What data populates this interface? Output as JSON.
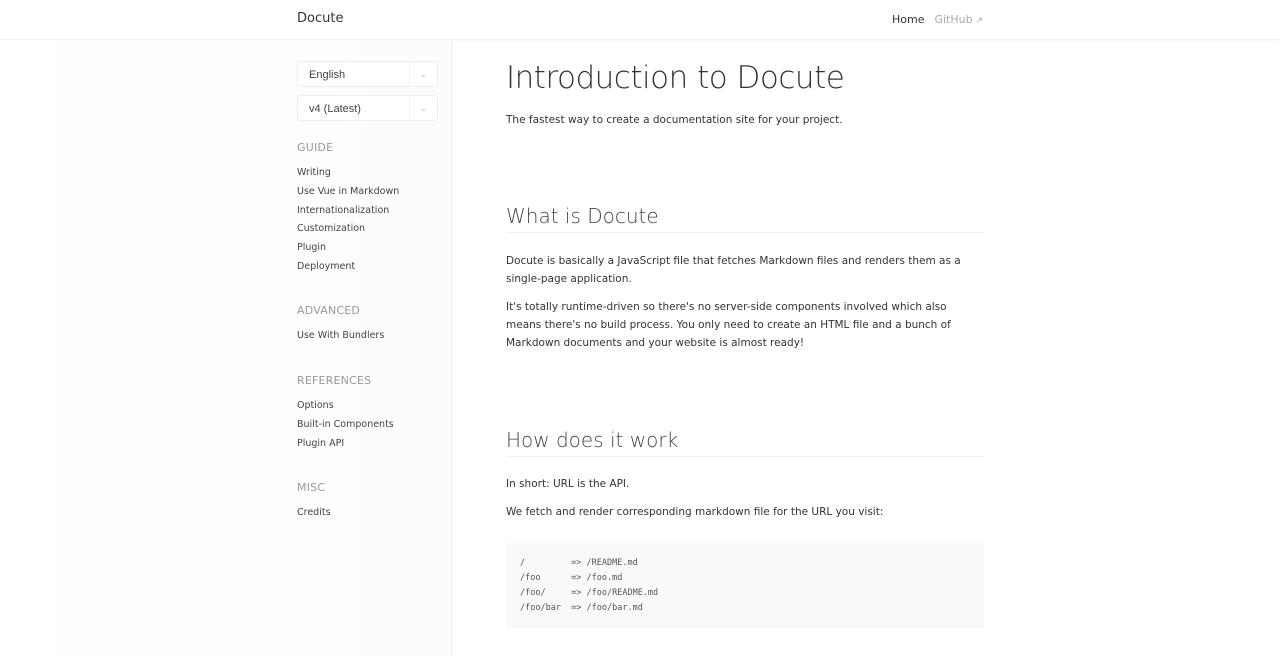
{
  "header": {
    "logo": "Docute",
    "nav": [
      {
        "label": "Home"
      },
      {
        "label": "GitHub"
      }
    ]
  },
  "sidebar": {
    "language": "English",
    "version": "v4 (Latest)",
    "sections": [
      {
        "title": "GUIDE",
        "items": [
          "Writing",
          "Use Vue in Markdown",
          "Internationalization",
          "Customization",
          "Plugin",
          "Deployment"
        ]
      },
      {
        "title": "ADVANCED",
        "items": [
          "Use With Bundlers"
        ]
      },
      {
        "title": "REFERENCES",
        "items": [
          "Options",
          "Built-in Components",
          "Plugin API"
        ]
      },
      {
        "title": "MISC",
        "items": [
          "Credits"
        ]
      }
    ]
  },
  "main": {
    "title": "Introduction to Docute",
    "subtitle": "The fastest way to create a documentation site for your project.",
    "h_what": "What is Docute",
    "p1": "Docute is basically a JavaScript file that fetches Markdown files and renders them as a single-page application.",
    "p2": "It's totally runtime-driven so there's no server-side components involved which also means there's no build process. You only need to create an HTML file and a bunch of Markdown documents and your website is almost ready!",
    "h_how": "How does it work",
    "p3": "In short: URL is the API.",
    "p4": "We fetch and render corresponding markdown file for the URL you visit:",
    "code": "/         => /README.md\n/foo      => /foo.md\n/foo/     => /foo/README.md\n/foo/bar  => /foo/bar.md"
  }
}
